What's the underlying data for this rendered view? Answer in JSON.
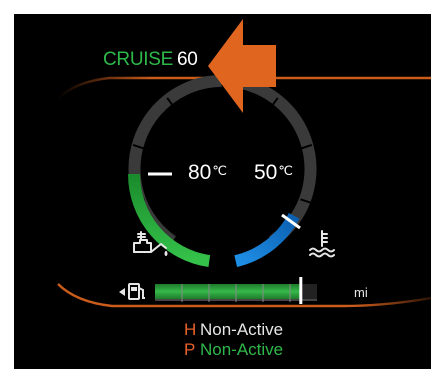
{
  "cruise": {
    "label": "CRUISE",
    "speed": "60"
  },
  "gauges": {
    "oil_temp": {
      "value": "80",
      "unit": "℃"
    },
    "coolant_temp": {
      "value": "50",
      "unit": "℃"
    }
  },
  "fuel": {
    "unit": "mi",
    "level": 0.9
  },
  "status": [
    {
      "letter": "H",
      "state": "Non-Active"
    },
    {
      "letter": "P",
      "state": "Non-Active"
    }
  ],
  "colors": {
    "accent_orange": "#e0661f",
    "active_green": "#2fb84a",
    "coolant_blue": "#1f8fe6",
    "background": "#000000"
  },
  "icons": [
    "oil-can-icon",
    "coolant-temperature-icon",
    "fuel-pump-icon",
    "pointer-arrow-icon"
  ]
}
